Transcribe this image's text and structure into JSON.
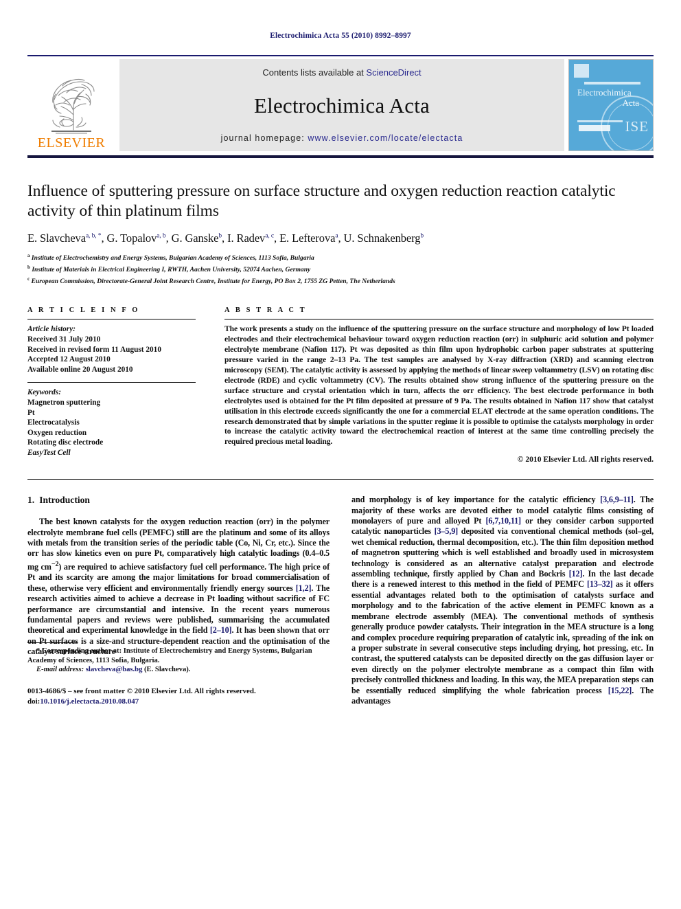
{
  "running_head": "Electrochimica Acta 55 (2010) 8992–8997",
  "masthead": {
    "publisher_name": "ELSEVIER",
    "contents_prefix": "Contents lists available at",
    "contents_link": "ScienceDirect",
    "journal_name": "Electrochimica Acta",
    "homepage_prefix": "journal homepage:",
    "homepage_url": "www.elsevier.com/locate/electacta",
    "cover": {
      "title_line1": "Electrochimica",
      "title_line2": "Acta",
      "seal_text": "ISE"
    }
  },
  "article": {
    "title": "Influence of sputtering pressure on surface structure and oxygen reduction reaction catalytic activity of thin platinum films",
    "authors": [
      {
        "name": "E. Slavcheva",
        "marks": "a, b, *"
      },
      {
        "name": "G. Topalov",
        "marks": "a, b"
      },
      {
        "name": "G. Ganske",
        "marks": "b"
      },
      {
        "name": "I. Radev",
        "marks": "a, c"
      },
      {
        "name": "E. Lefterova",
        "marks": "a"
      },
      {
        "name": "U. Schnakenberg",
        "marks": "b"
      }
    ],
    "affiliations": [
      {
        "mark": "a",
        "text": "Institute of Electrochemistry and Energy Systems, Bulgarian Academy of Sciences, 1113 Sofia, Bulgaria"
      },
      {
        "mark": "b",
        "text": "Institute of Materials in Electrical Engineering I, RWTH, Aachen University, 52074 Aachen, Germany"
      },
      {
        "mark": "c",
        "text": "European Commission, Directorate-General Joint Research Centre, Institute for Energy, PO Box 2, 1755 ZG Petten, The Netherlands"
      }
    ]
  },
  "article_info": {
    "heading": "A R T I C L E    I N F O",
    "history_label": "Article history:",
    "history": [
      "Received 31 July 2010",
      "Received in revised form 11 August 2010",
      "Accepted 12 August 2010",
      "Available online 20 August 2010"
    ],
    "keywords_label": "Keywords:",
    "keywords": [
      "Magnetron sputtering",
      "Pt",
      "Electrocatalysis",
      "Oxygen reduction",
      "Rotating disc electrode",
      "EasyTest Cell"
    ]
  },
  "abstract": {
    "heading": "A B S T R A C T",
    "text": "The work presents a study on the influence of the sputtering pressure on the surface structure and morphology of low Pt loaded electrodes and their electrochemical behaviour toward oxygen reduction reaction (orr) in sulphuric acid solution and polymer electrolyte membrane (Nafion 117). Pt was deposited as thin film upon hydrophobic carbon paper substrates at sputtering pressure varied in the range 2–13 Pa. The test samples are analysed by X-ray diffraction (XRD) and scanning electron microscopy (SEM). The catalytic activity is assessed by applying the methods of linear sweep voltammetry (LSV) on rotating disc electrode (RDE) and cyclic voltammetry (CV). The results obtained show strong influence of the sputtering pressure on the surface structure and crystal orientation which in turn, affects the orr efficiency. The best electrode performance in both electrolytes used is obtained for the Pt film deposited at pressure of 9 Pa. The results obtained in Nafion 117 show that catalyst utilisation in this electrode exceeds significantly the one for a commercial ELAT electrode at the same operation conditions. The research demonstrated that by simple variations in the sputter regime it is possible to optimise the catalysts morphology in order to increase the catalytic activity toward the electrochemical reaction of interest at the same time controlling precisely the required precious metal loading.",
    "copyright": "© 2010 Elsevier Ltd. All rights reserved."
  },
  "introduction": {
    "number": "1.",
    "heading": "Introduction",
    "paragraph_left_1": "The best known catalysts for the oxygen reduction reaction (orr) in the polymer electrolyte membrane fuel cells (PEMFC) still are the platinum and some of its alloys with metals from the transition series of the periodic table (Co, Ni, Cr, etc.). Since the orr has slow kinetics even on pure Pt, comparatively high catalytic loadings (0.4–0.5 mg cm",
    "paragraph_left_1b": ") are required to achieve satisfactory fuel cell performance. The high price of Pt and its scarcity are among the major limitations for broad commercialisation of these, otherwise very efficient and environmentally friendly energy sources ",
    "ref_1_2": "[1,2]",
    "paragraph_left_1c": ". The research activities aimed to achieve a decrease in Pt loading without sacrifice of FC performance are circumstantial and intensive. In the recent years numerous fundamental papers and reviews were published, summarising the accumulated theoretical and experimental knowledge in the field ",
    "ref_2_10": "[2–10]",
    "paragraph_left_1d": ". It has been shown that orr on Pt surfaces is a size-and structure-dependent reaction and the optimisation of the catalyst surface structure",
    "superscript_exp": "−2",
    "paragraph_right_1": "and morphology is of key importance for the catalytic efficiency ",
    "ref_3_6_9_11": "[3,6,9–11]",
    "paragraph_right_1b": ". The majority of these works are devoted either to model catalytic films consisting of monolayers of pure and alloyed Pt ",
    "ref_6_7_10_11": "[6,7,10,11]",
    "paragraph_right_1c": " or they consider carbon supported catalytic nanoparticles ",
    "ref_3_5_9": "[3–5,9]",
    "paragraph_right_1d": " deposited via conventional chemical methods (sol–gel, wet chemical reduction, thermal decomposition, etc.). The thin film deposition method of magnetron sputtering which is well established and broadly used in microsystem technology is considered as an alternative catalyst preparation and electrode assembling technique, firstly applied by Chan and Bockris ",
    "ref_12": "[12]",
    "paragraph_right_1e": ". In the last decade there is a renewed interest to this method in the field of PEMFC ",
    "ref_13_32": "[13–32]",
    "paragraph_right_1f": " as it offers essential advantages related both to the optimisation of catalysts surface and morphology and to the fabrication of the active element in PEMFC known as a membrane electrode assembly (MEA). The conventional methods of synthesis generally produce powder catalysts. Their integration in the MEA structure is a long and complex procedure requiring preparation of catalytic ink, spreading of the ink on a proper substrate in several consecutive steps including drying, hot pressing, etc. In contrast, the sputtered catalysts can be deposited directly on the gas diffusion layer or even directly on the polymer electrolyte membrane as a compact thin film with precisely controlled thickness and loading. In this way, the MEA preparation steps can be essentially reduced simplifying the whole fabrication process ",
    "ref_15_22": "[15,22]",
    "paragraph_right_1g": ". The advantages"
  },
  "footnotes": {
    "corresponding": "* Corresponding author at: Institute of Electrochemistry and Energy Systems, Bulgarian Academy of Sciences, 1113 Sofia, Bulgaria.",
    "email_label": "E-mail address:",
    "email": "slavcheva@bas.bg",
    "email_owner": "(E. Slavcheva).",
    "imprint_line1": "0013-4686/$ – see front matter © 2010 Elsevier Ltd. All rights reserved.",
    "doi_label": "doi:",
    "doi_value": "10.1016/j.electacta.2010.08.047"
  },
  "colors": {
    "link_blue": "#1a1a6e",
    "elsevier_orange": "#ef7d00",
    "cover_blue": "#56a9d8",
    "masthead_grey": "#e6e6e6"
  }
}
